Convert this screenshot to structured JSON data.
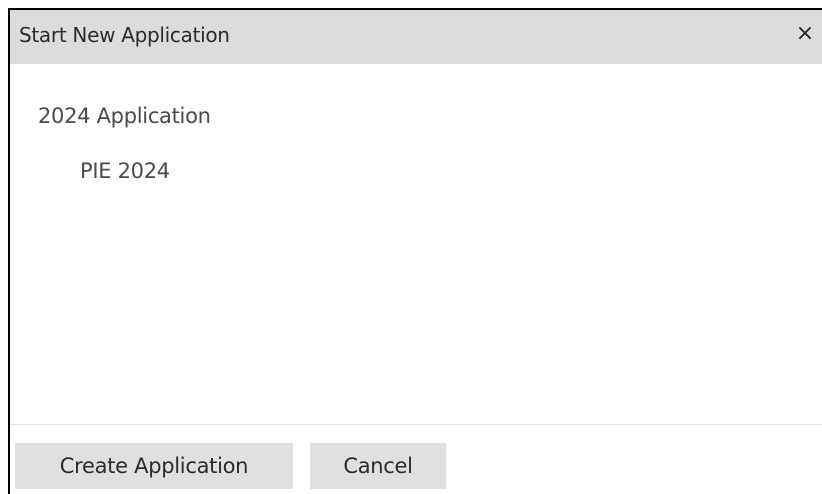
{
  "dialog": {
    "title": "Start New Application",
    "close_label": "×"
  },
  "tree": {
    "parent_label": "2024 Application",
    "child_label": "PIE 2024"
  },
  "footer": {
    "create_label": "Create Application",
    "cancel_label": "Cancel"
  }
}
